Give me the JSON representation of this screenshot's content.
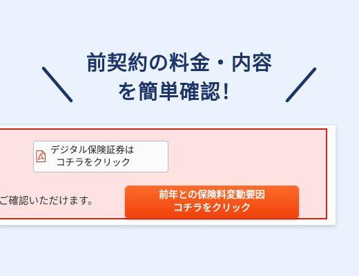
{
  "heading": {
    "line1": "前契約の料金・内容",
    "line2": "を簡単確認！"
  },
  "pdf_button": {
    "icon": "pdf-file-icon",
    "line1": "デジタル保険証券は",
    "line2": "コチラをクリック"
  },
  "confirm_text": "ご確認いただけます。",
  "diff_button": {
    "line1": "前年との保険料変動要因",
    "line2": "コチラをクリック"
  },
  "colors": {
    "background": "#e9f2fd",
    "heading": "#1d3466",
    "panel_border": "#d91f16",
    "panel_background": "#fde2e2",
    "cta": "#f4511e"
  }
}
